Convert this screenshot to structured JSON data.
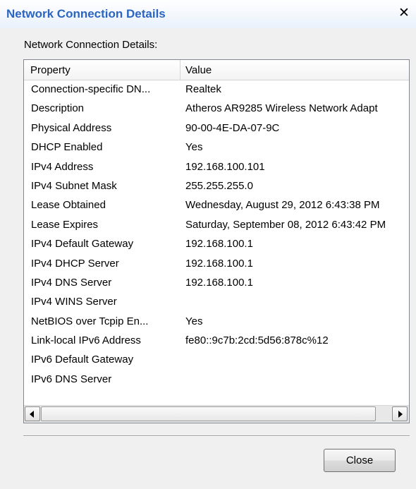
{
  "window": {
    "title": "Network Connection Details",
    "close_glyph": "✕"
  },
  "group_label": "Network Connection Details:",
  "table": {
    "columns": [
      "Property",
      "Value"
    ],
    "rows": [
      {
        "property": "Connection-specific DN...",
        "value": "Realtek"
      },
      {
        "property": "Description",
        "value": "Atheros AR9285 Wireless Network Adapt"
      },
      {
        "property": "Physical Address",
        "value": "90-00-4E-DA-07-9C"
      },
      {
        "property": "DHCP Enabled",
        "value": "Yes"
      },
      {
        "property": "IPv4 Address",
        "value": "192.168.100.101"
      },
      {
        "property": "IPv4 Subnet Mask",
        "value": "255.255.255.0"
      },
      {
        "property": "Lease Obtained",
        "value": "Wednesday, August 29, 2012 6:43:38 PM"
      },
      {
        "property": "Lease Expires",
        "value": "Saturday, September 08, 2012 6:43:42 PM"
      },
      {
        "property": "IPv4 Default Gateway",
        "value": "192.168.100.1"
      },
      {
        "property": "IPv4 DHCP Server",
        "value": "192.168.100.1"
      },
      {
        "property": "IPv4 DNS Server",
        "value": "192.168.100.1"
      },
      {
        "property": "IPv4 WINS Server",
        "value": ""
      },
      {
        "property": "NetBIOS over Tcpip En...",
        "value": "Yes"
      },
      {
        "property": "Link-local IPv6 Address",
        "value": "fe80::9c7b:2cd:5d56:878c%12"
      },
      {
        "property": "IPv6 Default Gateway",
        "value": ""
      },
      {
        "property": "IPv6 DNS Server",
        "value": ""
      }
    ]
  },
  "buttons": {
    "close_label": "Close"
  },
  "icons": {
    "scroll_left": "chevron-left-icon",
    "scroll_right": "chevron-right-icon",
    "title_close": "close-icon"
  },
  "colors": {
    "title_text": "#2b65c2",
    "dialog_background": "#f0f0f0"
  }
}
